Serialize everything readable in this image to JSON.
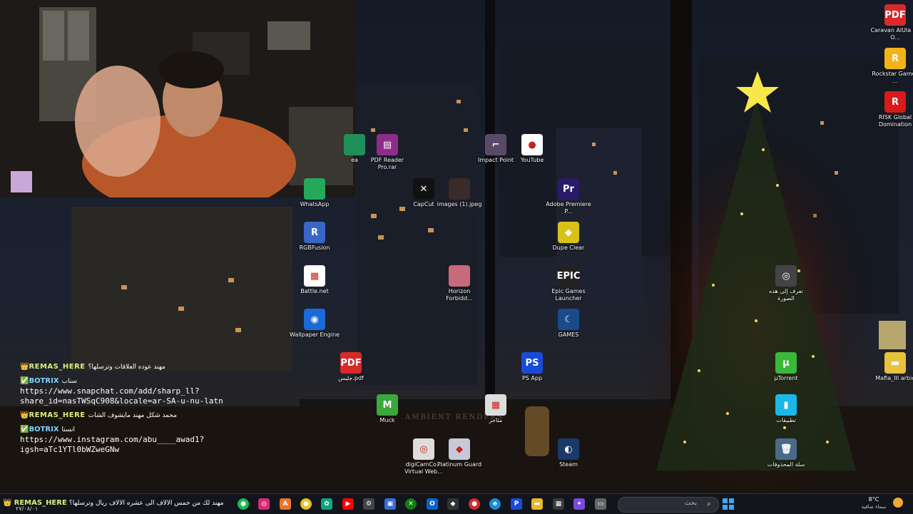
{
  "desktop": {
    "icons": [
      {
        "id": "ea",
        "label": "ea",
        "glyph": "",
        "color": "#1f8f5a"
      },
      {
        "id": "pdfreader",
        "label": "PDF Reader Pro.rar",
        "glyph": "▤",
        "color": "#8e2c8a"
      },
      {
        "id": "impact",
        "label": "Impact Point",
        "glyph": "⌐",
        "color": "#5a4a6a"
      },
      {
        "id": "youtube",
        "label": "YouTube",
        "glyph": "●",
        "color": "#ffffff"
      },
      {
        "id": "whatsapp",
        "label": "WhatsApp",
        "glyph": "",
        "color": "#25a85a"
      },
      {
        "id": "capcut",
        "label": "CapCut",
        "glyph": "✕",
        "color": "#111111"
      },
      {
        "id": "images",
        "label": "images (1).jpeg",
        "glyph": "",
        "color": "#3a2a2a"
      },
      {
        "id": "premiere",
        "label": "Adobe Premiere P...",
        "glyph": "Pr",
        "color": "#2a1a6a"
      },
      {
        "id": "rgbfusion",
        "label": "RGBFusion",
        "glyph": "R",
        "color": "#3a66c8"
      },
      {
        "id": "dupeclear",
        "label": "Dupe Clear",
        "glyph": "◆",
        "color": "#d8c21a"
      },
      {
        "id": "battlenet",
        "label": "Battle.net",
        "glyph": "▦",
        "color": "#ffffff"
      },
      {
        "id": "horizon",
        "label": "Horizon Forbidd...",
        "glyph": "",
        "color": "#c86a7a"
      },
      {
        "id": "epic",
        "label": "Epic Games Launcher",
        "glyph": "EPIC",
        "color": "#222222"
      },
      {
        "id": "wallpaper",
        "label": "Wallpaper Engine",
        "glyph": "◉",
        "color": "#1a6ad8"
      },
      {
        "id": "games",
        "label": "GAMES",
        "glyph": "☾",
        "color": "#1a4a8a"
      },
      {
        "id": "jalees",
        "label": "جليس.pdf",
        "glyph": "PDF",
        "color": "#d82a2a"
      },
      {
        "id": "psapp",
        "label": "PS App",
        "glyph": "PS",
        "color": "#1a4ad8"
      },
      {
        "id": "muck",
        "label": "Muck",
        "glyph": "M",
        "color": "#3aa83a"
      },
      {
        "id": "store",
        "label": "متاجر",
        "glyph": "▦",
        "color": "#dddddd"
      },
      {
        "id": "digicam",
        "label": "digiCamCo... Virtual Web...",
        "glyph": "◎",
        "color": "#dddddd"
      },
      {
        "id": "platinum",
        "label": "Platinum Guard",
        "glyph": "◆",
        "color": "#c8c8d8"
      },
      {
        "id": "steam",
        "label": "Steam",
        "glyph": "◐",
        "color": "#1a3a6a"
      },
      {
        "id": "caravan",
        "label": "Caravan AlUla by O...",
        "glyph": "PDF",
        "color": "#d82a2a"
      },
      {
        "id": "rockstar",
        "label": "Rockstar Games ...",
        "glyph": "R",
        "color": "#f2b31a"
      },
      {
        "id": "risk",
        "label": "RISK Global Domination",
        "glyph": "R",
        "color": "#d81a1a"
      },
      {
        "id": "learn",
        "label": "تعرف إلى هذه الصورة",
        "glyph": "◎",
        "color": "#444444"
      },
      {
        "id": "utorrent",
        "label": "µTorrent",
        "glyph": "µ",
        "color": "#3ab83a"
      },
      {
        "id": "apps",
        "label": "تطبيقات",
        "glyph": "▮",
        "color": "#1ab8e8"
      },
      {
        "id": "mafia",
        "label": "Mafia_III arbic",
        "glyph": "▬",
        "color": "#e8c23a"
      },
      {
        "id": "recycle",
        "label": "سلة المحذوفات",
        "glyph": "🗑",
        "color": "#4a6a8a"
      }
    ],
    "watermark": "AMBIENT RENDERS"
  },
  "chat": {
    "messages": [
      {
        "user": "REMAS_HERE",
        "badge": "👑",
        "text": "مهند عوده العلاقات وترسلها؟",
        "url_lines": []
      },
      {
        "user": "BOTRIX",
        "badge": "✅",
        "text": "سناب",
        "url_lines": [
          "https://www.snapchat.com/add/sharp_ll?",
          "share_id=nasTWSqC908&locale=ar-SA-u-nu-latn"
        ]
      },
      {
        "user": "REMAS_HERE",
        "badge": "👑",
        "text": "محمد شكل مهند مايشوف الشات",
        "url_lines": []
      },
      {
        "user": "BOTRIX",
        "badge": "✅",
        "text": "انستا",
        "url_lines": [
          "https://www.instagram.com/abu____awad1?",
          "igsh=aTc1YTl0bWZweGNw"
        ]
      }
    ],
    "bottom": {
      "user": "REMAS_HERE",
      "text": "مهند لك من خمس الالاف الى عشره الالاف ريال وترسلها؟"
    }
  },
  "taskbar": {
    "search_placeholder": "بحث",
    "weather_temp": "8°C",
    "weather_desc": "سماء صافية",
    "date_fragment": "٢٧/٠٨/٠١"
  }
}
